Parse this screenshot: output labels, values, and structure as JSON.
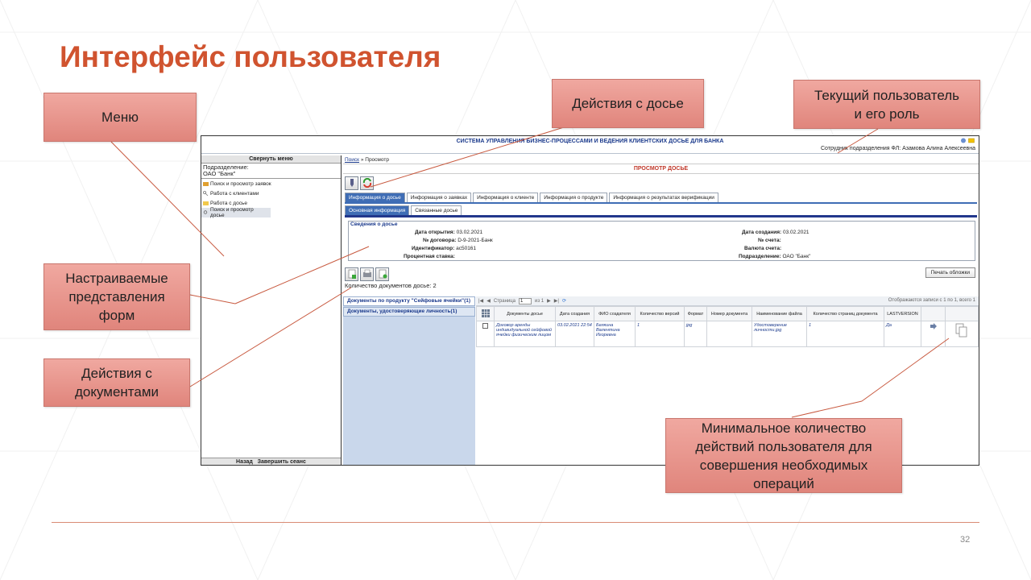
{
  "slide": {
    "title": "Интерфейс пользователя",
    "page_number": "32"
  },
  "callouts": {
    "menu": "Меню",
    "dossier_actions": "Действия с досье",
    "current_user": "Текущий пользователь\nи его роль",
    "custom_forms": "Настраиваемые\nпредставления\nформ",
    "doc_actions": "Действия с\nдокументами",
    "min_actions": "Минимальное количество\nдействий пользователя для\nсовершения необходимых\nопераций"
  },
  "app": {
    "title": "СИСТЕМА УПРАВЛЕНИЯ БИЗНЕС-ПРОЦЕССАМИ И ВЕДЕНИЯ КЛИЕНТСКИХ ДОСЬЕ ДЛЯ БАНКА",
    "user": "Сотрудник подразделения ФЛ: Азамова Алина Алексеевна",
    "sidebar": {
      "collapse": "Свернуть меню",
      "dept_label": "Подразделение:",
      "dept_value": "ОАО \"Банк\"",
      "items": [
        {
          "label": "Поиск и просмотр заявок",
          "icon": "search-folder-icon"
        },
        {
          "label": "Работа с клиентами",
          "icon": "key-icon"
        },
        {
          "label": "Работа с досье",
          "icon": "folder-icon"
        },
        {
          "label": "Поиск и просмотр досье",
          "icon": "search-icon"
        }
      ],
      "footer_back": "Назад",
      "footer_end": "Завершить сеанс"
    },
    "breadcrumb": {
      "link": "Поиск",
      "separator": "»",
      "current": "Просмотр"
    },
    "view_title": "ПРОСМОТР ДОСЬЕ",
    "tabs": [
      "Информация о досье",
      "Информация о заявках",
      "Информация о клиенте",
      "Информация о продукте",
      "Информация о результатах верификации"
    ],
    "subtabs": [
      "Основная информация",
      "Связанные досье"
    ],
    "dossier": {
      "legend": "Сведения о досье",
      "left": [
        {
          "label": "Дата открытия:",
          "value": "03.02.2021"
        },
        {
          "label": "№ договора:",
          "value": "D-9-2021-Банк"
        },
        {
          "label": "Идентификатор:",
          "value": "ac50161"
        },
        {
          "label": "Процентная ставка:",
          "value": ""
        }
      ],
      "right": [
        {
          "label": "Дата создания:",
          "value": "03.02.2021"
        },
        {
          "label": "№ счета:",
          "value": ""
        },
        {
          "label": "Валюта счета:",
          "value": ""
        },
        {
          "label": "Подразделение:",
          "value": "ОАО \"Банк\""
        }
      ]
    },
    "print_button": "Печать обложки",
    "doc_count": "Количество документов досье: 2",
    "doc_categories": [
      "Документы по продукту \"Сейфовые ячейки\"(1)",
      "Документы, удостоверяющие личность(1)"
    ],
    "pager": {
      "page_label": "Страница",
      "page_value": "1",
      "of_label": "из 1",
      "records": "Отображаются записи с 1 по 1, всего 1"
    },
    "columns": [
      "Документы досье",
      "Дата создания",
      "ФИО создателя",
      "Количество версий",
      "Формат",
      "Номер документа",
      "Наименование файла",
      "Количество страниц документа",
      "LASTVERSION"
    ],
    "rows": [
      {
        "doc": "Договор аренды индивидуальной сейфовой ячейки физическим лицом",
        "created": "03.02.2021 22:54",
        "creator": "Белкина Валентина Игоревна",
        "versions": "1",
        "format": "jpg",
        "number": "",
        "filename": "Удостоверение личности.jpg",
        "pages": "1",
        "lastversion": "Да"
      }
    ]
  }
}
